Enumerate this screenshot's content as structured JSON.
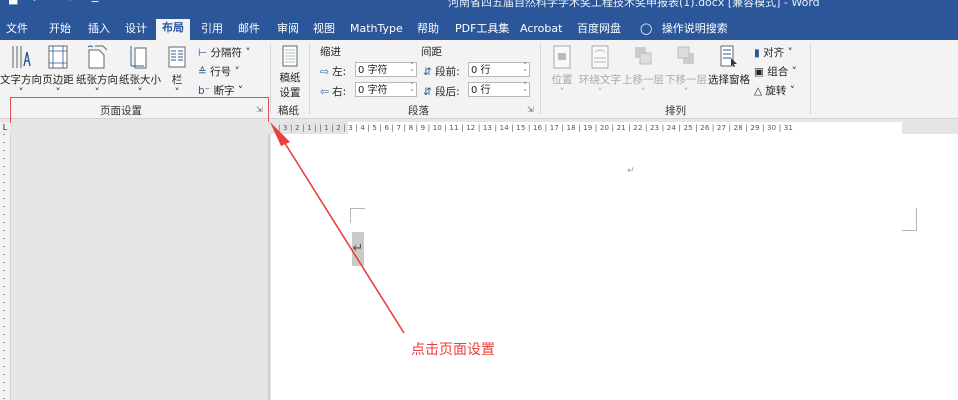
{
  "titlebar": {
    "doc_title": "河南省四五届自然科学学术奖工程技术奖申报表(1).docx [兼容模式] - Word",
    "qat_save": "■",
    "qat_undo": "↶ ˅",
    "qat_redo": "↷",
    "qat_more": "≡"
  },
  "tabs": [
    {
      "label": "文件"
    },
    {
      "label": "开始"
    },
    {
      "label": "插入"
    },
    {
      "label": "设计"
    },
    {
      "label": "布局"
    },
    {
      "label": "引用"
    },
    {
      "label": "邮件"
    },
    {
      "label": "审阅"
    },
    {
      "label": "视图"
    },
    {
      "label": "MathType"
    },
    {
      "label": "帮助"
    },
    {
      "label": "PDF工具集"
    },
    {
      "label": "Acrobat"
    },
    {
      "label": "百度网盘"
    },
    {
      "label": "操作说明搜索"
    }
  ],
  "ribbon": {
    "page_setup": {
      "text_direction": "文字方向",
      "margins": "页边距",
      "orientation": "纸张方向",
      "size": "纸张大小",
      "columns": "栏",
      "breaks": "分隔符",
      "line_numbers": "行号",
      "hyphenation": "断字",
      "dropdown_mark": "˅",
      "title": "页面设置",
      "launcher": "⇲"
    },
    "manuscript": {
      "label_line1": "稿纸",
      "label_line2": "设置",
      "title": "稿纸"
    },
    "paragraph": {
      "indent_header": "缩进",
      "spacing_header": "间距",
      "left_label": "左:",
      "right_label": "右:",
      "before_label": "段前:",
      "after_label": "段后:",
      "left_value": "0 字符",
      "right_value": "0 字符",
      "before_value": "0 行",
      "after_value": "0 行",
      "spin_arrows": "˄\n˅",
      "title": "段落",
      "launcher": "⇲"
    },
    "arrange": {
      "position": "位置",
      "wrap_text": "环绕文字",
      "bring_forward": "上移一层",
      "send_backward": "下移一层",
      "selection_pane": "选择窗格",
      "align": "对齐",
      "group": "组合",
      "rotate": "旋转",
      "dropdown_mark": "˅",
      "title": "排列"
    }
  },
  "ruler": {
    "corner": "L",
    "numbers": "| 3 | 2 | 1 |   | 1 | 2 | 3 | 4 | 5 | 6 | 7 | 8 | 9 | 10 | 11 | 12 | 13 | 14 | 15 | 16 | 17 | 18 | 19 | 20 | 21 | 22 | 23 | 24 | 25 | 26 | 27 | 28 | 29 | 30 | 31"
  },
  "document": {
    "paragraph_mark": "↵",
    "cursor_mark": "↵"
  },
  "annotation": {
    "text": "点击页面设置",
    "color": "#e8403c"
  },
  "colors": {
    "ribbon_blue": "#2b579a",
    "ribbon_bg": "#f3f3f3"
  }
}
